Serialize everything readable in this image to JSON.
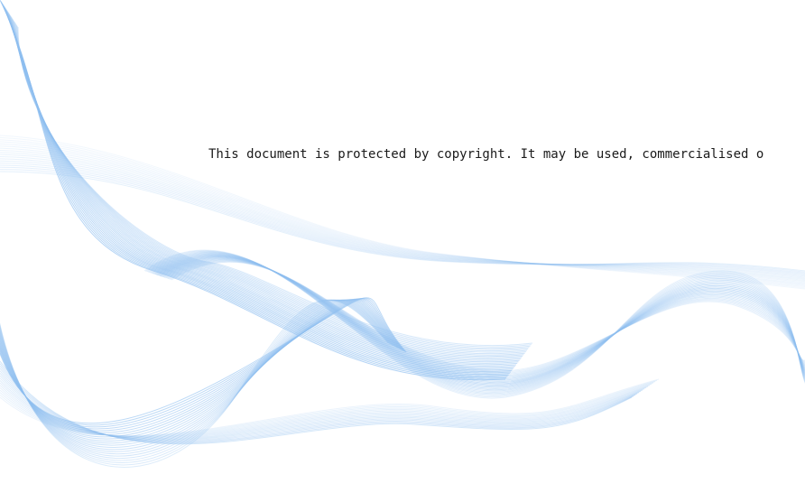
{
  "document": {
    "copyright_notice": "This document is protected by copyright. It may be used, commercialised o",
    "wave_color": "#8fbff0"
  }
}
